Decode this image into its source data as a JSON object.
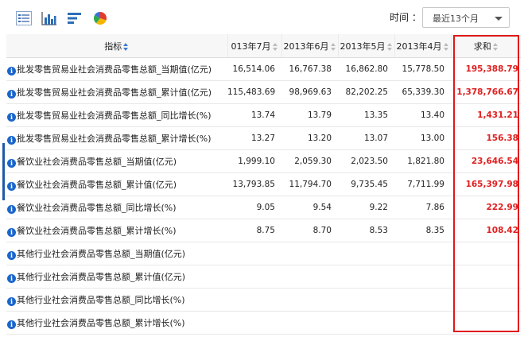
{
  "toolbar": {
    "icons": [
      "list-view-icon",
      "bar-chart-icon",
      "bar-list-icon",
      "pie-chart-icon"
    ],
    "time_label": "时间 ：",
    "time_value": "最近13个月"
  },
  "table": {
    "headers": [
      "指标",
      "013年7月",
      "2013年6月",
      "2013年5月",
      "2013年4月",
      "求和"
    ],
    "rows": [
      {
        "name": "批发零售贸易业社会消费品零售总额_当期值(亿元)",
        "v": [
          "16,514.06",
          "16,767.38",
          "16,862.80",
          "15,778.50"
        ],
        "sum": "195,388.79"
      },
      {
        "name": "批发零售贸易业社会消费品零售总额_累计值(亿元)",
        "v": [
          "115,483.69",
          "98,969.63",
          "82,202.25",
          "65,339.30"
        ],
        "sum": "1,378,766.67"
      },
      {
        "name": "批发零售贸易业社会消费品零售总额_同比增长(%)",
        "v": [
          "13.74",
          "13.79",
          "13.35",
          "13.40"
        ],
        "sum": "1,431.21"
      },
      {
        "name": "批发零售贸易业社会消费品零售总额_累计增长(%)",
        "v": [
          "13.27",
          "13.20",
          "13.07",
          "13.00"
        ],
        "sum": "156.38"
      },
      {
        "name": "餐饮业社会消费品零售总额_当期值(亿元)",
        "v": [
          "1,999.10",
          "2,059.30",
          "2,023.50",
          "1,821.80"
        ],
        "sum": "23,646.54"
      },
      {
        "name": "餐饮业社会消费品零售总额_累计值(亿元)",
        "v": [
          "13,793.85",
          "11,794.70",
          "9,735.45",
          "7,711.99"
        ],
        "sum": "165,397.98"
      },
      {
        "name": "餐饮业社会消费品零售总额_同比增长(%)",
        "v": [
          "9.05",
          "9.54",
          "9.22",
          "7.86"
        ],
        "sum": "222.99"
      },
      {
        "name": "餐饮业社会消费品零售总额_累计增长(%)",
        "v": [
          "8.75",
          "8.70",
          "8.53",
          "8.35"
        ],
        "sum": "108.42"
      },
      {
        "name": "其他行业社会消费品零售总额_当期值(亿元)",
        "v": [
          "",
          "",
          "",
          ""
        ],
        "sum": ""
      },
      {
        "name": "其他行业社会消费品零售总额_累计值(亿元)",
        "v": [
          "",
          "",
          "",
          ""
        ],
        "sum": ""
      },
      {
        "name": "其他行业社会消费品零售总额_同比增长(%)",
        "v": [
          "",
          "",
          "",
          ""
        ],
        "sum": ""
      },
      {
        "name": "其他行业社会消费品零售总额_累计增长(%)",
        "v": [
          "",
          "",
          "",
          ""
        ],
        "sum": ""
      }
    ]
  },
  "colors": {
    "sum_text": "#e02020",
    "highlight_box": "#e01818",
    "info_icon": "#1a66cc",
    "row_marker": "#1e5aa8"
  }
}
